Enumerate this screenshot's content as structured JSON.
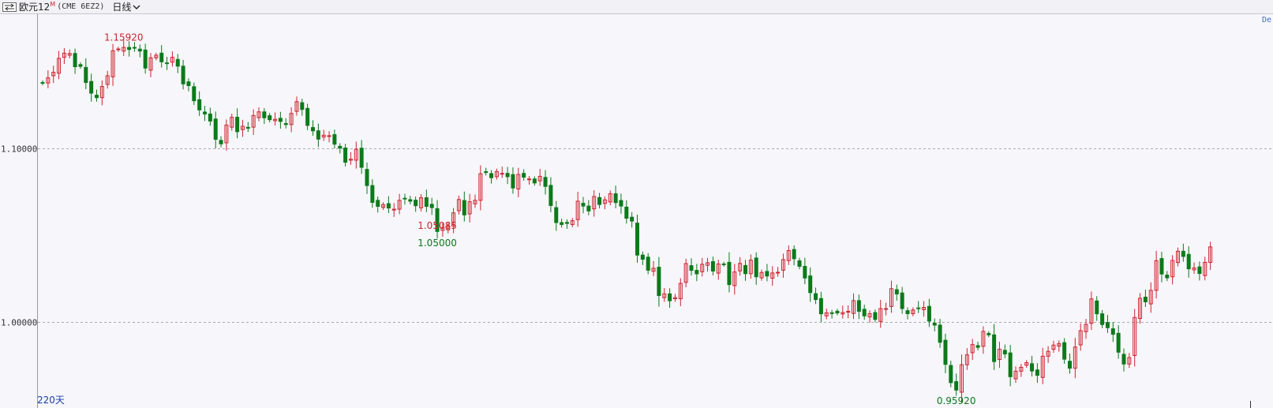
{
  "header": {
    "title": "欧元12",
    "title_superscript": "M",
    "code": "(CME 6EZ2)",
    "period_label": "日线",
    "right_tag": "De",
    "icons": {
      "swap": "swap-arrows-icon",
      "period_dropdown": "chevron-down-icon"
    }
  },
  "footer": {
    "days_label": "220天"
  },
  "colors": {
    "up": "#d0232d",
    "down": "#0b7a1a",
    "grid": "#aaaaaa",
    "y_tick": "#333333",
    "days": "#1a3fa8"
  },
  "chart_data": {
    "type": "candlestick",
    "y_ticks": [
      1.0,
      1.1
    ],
    "y_tick_labels": [
      "1.00000",
      "1.10000"
    ],
    "ylim": [
      0.9505,
      1.1771
    ],
    "grid": "horizontal dashed",
    "closes": [
      1.1375,
      1.1405,
      1.1437,
      1.1517,
      1.1547,
      1.1545,
      1.1469,
      1.1471,
      1.1378,
      1.1317,
      1.1291,
      1.1355,
      1.1417,
      1.1561,
      1.1571,
      1.158,
      1.1568,
      1.1576,
      1.1559,
      1.1461,
      1.152,
      1.1535,
      1.1497,
      1.1489,
      1.1523,
      1.1472,
      1.137,
      1.136,
      1.1273,
      1.122,
      1.1197,
      1.1156,
      1.1051,
      1.1025,
      1.1133,
      1.1178,
      1.1095,
      1.1126,
      1.1115,
      1.1188,
      1.1209,
      1.1175,
      1.1164,
      1.1166,
      1.1154,
      1.1136,
      1.12,
      1.1268,
      1.1223,
      1.1131,
      1.11,
      1.1052,
      1.1075,
      1.1072,
      1.1023,
      1.1001,
      1.0919,
      1.0937,
      1.0994,
      1.089,
      1.0785,
      1.0688,
      1.0665,
      1.0675,
      1.0656,
      1.0649,
      1.07,
      1.071,
      1.0695,
      1.0669,
      1.0715,
      1.0665,
      1.0658,
      1.0521,
      1.0542,
      1.0552,
      1.0628,
      1.0705,
      1.0616,
      1.0692,
      1.07,
      1.0853,
      1.086,
      1.083,
      1.0866,
      1.0855,
      1.0836,
      1.0771,
      1.0849,
      1.0833,
      1.0823,
      1.08,
      1.0838,
      1.078,
      1.067,
      1.0572,
      1.0561,
      1.0567,
      1.0583,
      1.0695,
      1.0667,
      1.0639,
      1.0722,
      1.0676,
      1.0703,
      1.0738,
      1.0687,
      1.0667,
      1.0597,
      1.0581,
      1.0385,
      1.0361,
      1.0298,
      1.0309,
      1.0152,
      1.0162,
      1.0122,
      1.014,
      1.0222,
      1.0336,
      1.0297,
      1.0277,
      1.0332,
      1.0341,
      1.0293,
      1.0334,
      1.0331,
      1.0215,
      1.0288,
      1.0337,
      1.0278,
      1.0356,
      1.026,
      1.0285,
      1.0264,
      1.0282,
      1.0286,
      1.0359,
      1.0411,
      1.0364,
      1.032,
      1.0253,
      1.0169,
      1.0129,
      1.0047,
      1.0053,
      1.005,
      1.0052,
      1.0054,
      1.0061,
      1.0123,
      1.0061,
      1.0035,
      1.0048,
      1.0015,
      1.0077,
      1.0077,
      1.0192,
      1.0161,
      1.0077,
      1.0048,
      1.0069,
      1.0077,
      1.0084,
      1.0005,
      0.9982,
      0.9883,
      0.9756,
      0.9651,
      0.9608,
      0.9754,
      0.9811,
      0.987,
      0.9854,
      0.9946,
      0.9926,
      0.9772,
      0.9843,
      0.9816,
      0.9685,
      0.9717,
      0.9739,
      0.9766,
      0.9718,
      0.9693,
      0.9803,
      0.9831,
      0.9867,
      0.9875,
      0.9786,
      0.9734,
      0.9856,
      0.995,
      0.9986,
      1.0133,
      1.0047,
      0.9985,
      0.9967,
      0.9929,
      0.9826,
      0.9758,
      0.9795,
      1.0026,
      1.0137,
      1.0116,
      1.0182,
      1.0353,
      1.0276,
      1.0254,
      1.0354,
      1.0407,
      1.0377,
      1.0306,
      1.0311,
      1.0279,
      1.0343,
      1.0432
    ],
    "annotations": [
      {
        "text": "1.15920",
        "value": 1.1592,
        "kind": "high"
      },
      {
        "text": "1.05000",
        "value": 1.05,
        "kind": "low"
      },
      {
        "text": "1.05085",
        "value": 1.05085,
        "kind": "high"
      },
      {
        "text": "0.95920",
        "value": 0.9592,
        "kind": "low"
      }
    ]
  }
}
